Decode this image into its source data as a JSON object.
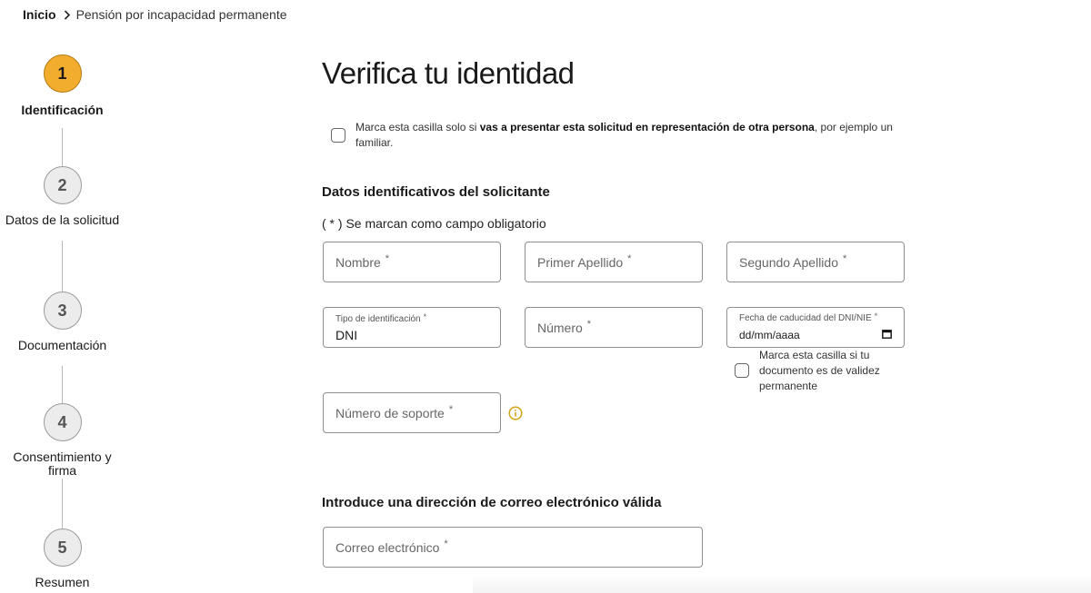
{
  "breadcrumb": {
    "home": "Inicio",
    "current": "Pensión por incapacidad permanente"
  },
  "stepper": {
    "steps": [
      {
        "number": "1",
        "label": "Identificación",
        "active": true
      },
      {
        "number": "2",
        "label": "Datos de la solicitud",
        "active": false
      },
      {
        "number": "3",
        "label": "Documentación",
        "active": false
      },
      {
        "number": "4",
        "label": "Consentimiento y firma",
        "active": false
      },
      {
        "number": "5",
        "label": "Resumen",
        "active": false
      }
    ]
  },
  "main": {
    "title": "Verifica tu identidad",
    "representation": {
      "prefix": "Marca esta casilla solo si ",
      "bold": "vas a presentar esta solicitud en representación de otra persona",
      "suffix": ", por ejemplo un familiar."
    },
    "applicant_section": "Datos identificativos del solicitante",
    "required_note": "( * ) Se marcan como campo obligatorio",
    "required_mark": "*",
    "fields": {
      "nombre": "Nombre",
      "primer_apellido": "Primer Apellido",
      "segundo_apellido": "Segundo Apellido",
      "tipo_identificacion_label": "Tipo de identificación",
      "tipo_identificacion_value": "DNI",
      "numero": "Número",
      "fecha_caducidad_label": "Fecha de caducidad del DNI/NIE",
      "fecha_caducidad_value": "dd/mm/aaaa",
      "numero_soporte": "Número de soporte",
      "correo": "Correo electrónico"
    },
    "permanent_checkbox": "Marca esta casilla si tu documento es de validez permanente",
    "email_section": "Introduce una dirección de correo electrónico válida"
  },
  "colors": {
    "active_step": "#f2ad2e",
    "info_icon": "#d4a51a"
  }
}
